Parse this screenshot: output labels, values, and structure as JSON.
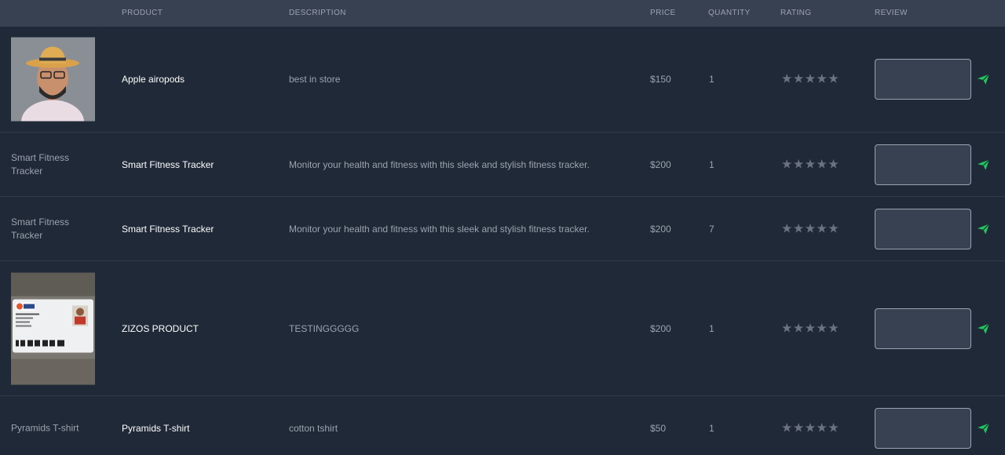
{
  "headers": {
    "product": "PRODUCT",
    "description": "DESCRIPTION",
    "price": "PRICE",
    "quantity": "QUANTITY",
    "rating": "RATING",
    "review": "REVIEW"
  },
  "rows": [
    {
      "image_alt": "",
      "image_kind": "photo-man-hat",
      "name": "Apple airopods",
      "description": "best in store",
      "price": "$150",
      "quantity": "1",
      "rating_stars": "★★★★★",
      "review_value": ""
    },
    {
      "image_alt": "Smart Fitness Tracker",
      "image_kind": "broken",
      "name": "Smart Fitness Tracker",
      "description": "Monitor your health and fitness with this sleek and stylish fitness tracker.",
      "price": "$200",
      "quantity": "1",
      "rating_stars": "★★★★★",
      "review_value": ""
    },
    {
      "image_alt": "Smart Fitness Tracker",
      "image_kind": "broken",
      "name": "Smart Fitness Tracker",
      "description": "Monitor your health and fitness with this sleek and stylish fitness tracker.",
      "price": "$200",
      "quantity": "7",
      "rating_stars": "★★★★★",
      "review_value": ""
    },
    {
      "image_alt": "",
      "image_kind": "photo-id-card",
      "name": "ZIZOS PRODUCT",
      "description": "TESTINGGGGG",
      "price": "$200",
      "quantity": "1",
      "rating_stars": "★★★★★",
      "review_value": ""
    },
    {
      "image_alt": "Pyramids T-shirt",
      "image_kind": "broken",
      "name": "Pyramids T-shirt",
      "description": "cotton tshirt",
      "price": "$50",
      "quantity": "1",
      "rating_stars": "★★★★★",
      "review_value": ""
    }
  ],
  "icons": {
    "send": "send-icon"
  },
  "colors": {
    "accent_send": "#22c55e",
    "star": "#6b7280",
    "header_bg": "#374151",
    "row_bg": "#1f2937"
  }
}
